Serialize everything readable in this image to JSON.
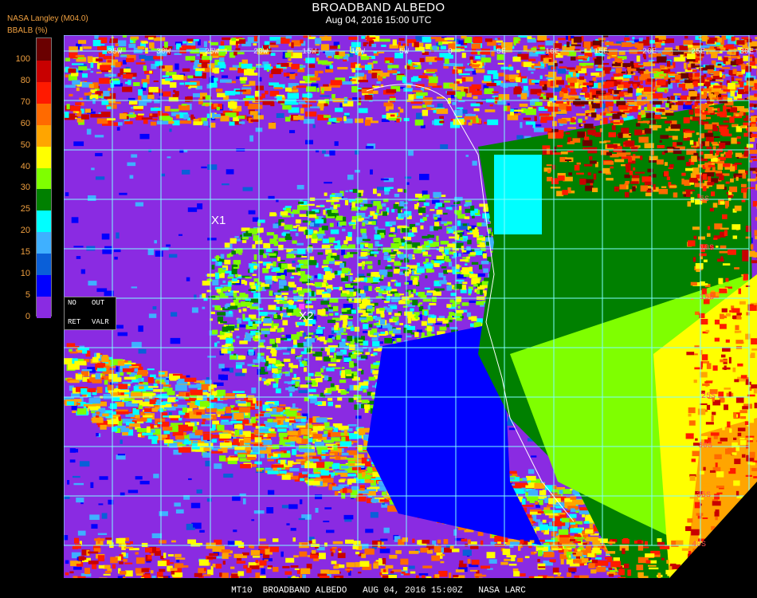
{
  "header": {
    "title": "BROADBAND ALBEDO",
    "subtitle": "Aug 04, 2016 15:00 UTC",
    "source": "NASA Langley (M04.0)"
  },
  "colorbar": {
    "label": "BBALB (%)",
    "ticks": [
      "0",
      "5",
      "10",
      "15",
      "20",
      "25",
      "30",
      "40",
      "50",
      "60",
      "70",
      "80",
      "100"
    ],
    "colors": [
      "#8a2be2",
      "#0000ff",
      "#0a5fd8",
      "#3fb0ff",
      "#00ffff",
      "#008000",
      "#7fff00",
      "#ffff00",
      "#ffa500",
      "#ff6a00",
      "#ff1a00",
      "#c80000",
      "#6a0000"
    ]
  },
  "legend_box": {
    "no": "NO",
    "out": "OUT",
    "ret": "RET",
    "valr": "VALR"
  },
  "markers": {
    "x1": "X1",
    "x2": "X2"
  },
  "lat_labels": [
    "5S",
    "10S",
    "15S",
    "25S",
    "30S",
    "35S",
    "40S"
  ],
  "lon_labels": [
    "35W",
    "30W",
    "25W",
    "20W",
    "15W",
    "10W",
    "5W",
    "0",
    "5E",
    "10E",
    "15E",
    "20E",
    "25E",
    "30E"
  ],
  "footer": "MT10  BROADBAND ALBEDO   AUG 04, 2016 15:00Z   NASA LARC"
}
